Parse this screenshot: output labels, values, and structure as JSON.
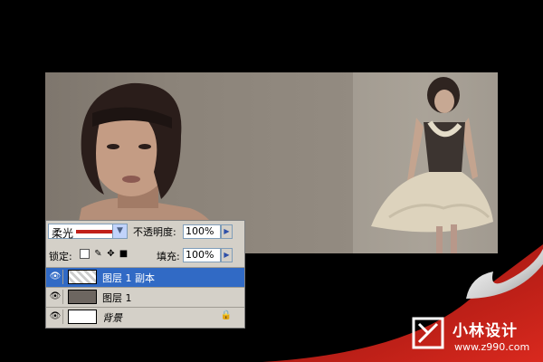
{
  "canvas": {
    "left_photo": "short-haired woman portrait",
    "right_photo": "woman in ruffled dress"
  },
  "layers_panel": {
    "blend_mode": "柔光",
    "opacity_label": "不透明度:",
    "opacity_value": "100%",
    "lock_label": "锁定:",
    "fill_label": "填充:",
    "fill_value": "100%",
    "layers": [
      {
        "name": "图层 1 副本",
        "selected": true
      },
      {
        "name": "图层 1",
        "selected": false
      },
      {
        "name": "背景",
        "selected": false,
        "locked": true
      }
    ]
  },
  "watermark": {
    "name": "小林设计",
    "url": "www.z990.com"
  },
  "colors": {
    "selection": "#316ac5",
    "panel_bg": "#d4d0c8",
    "curl_red": "#c0201a"
  }
}
